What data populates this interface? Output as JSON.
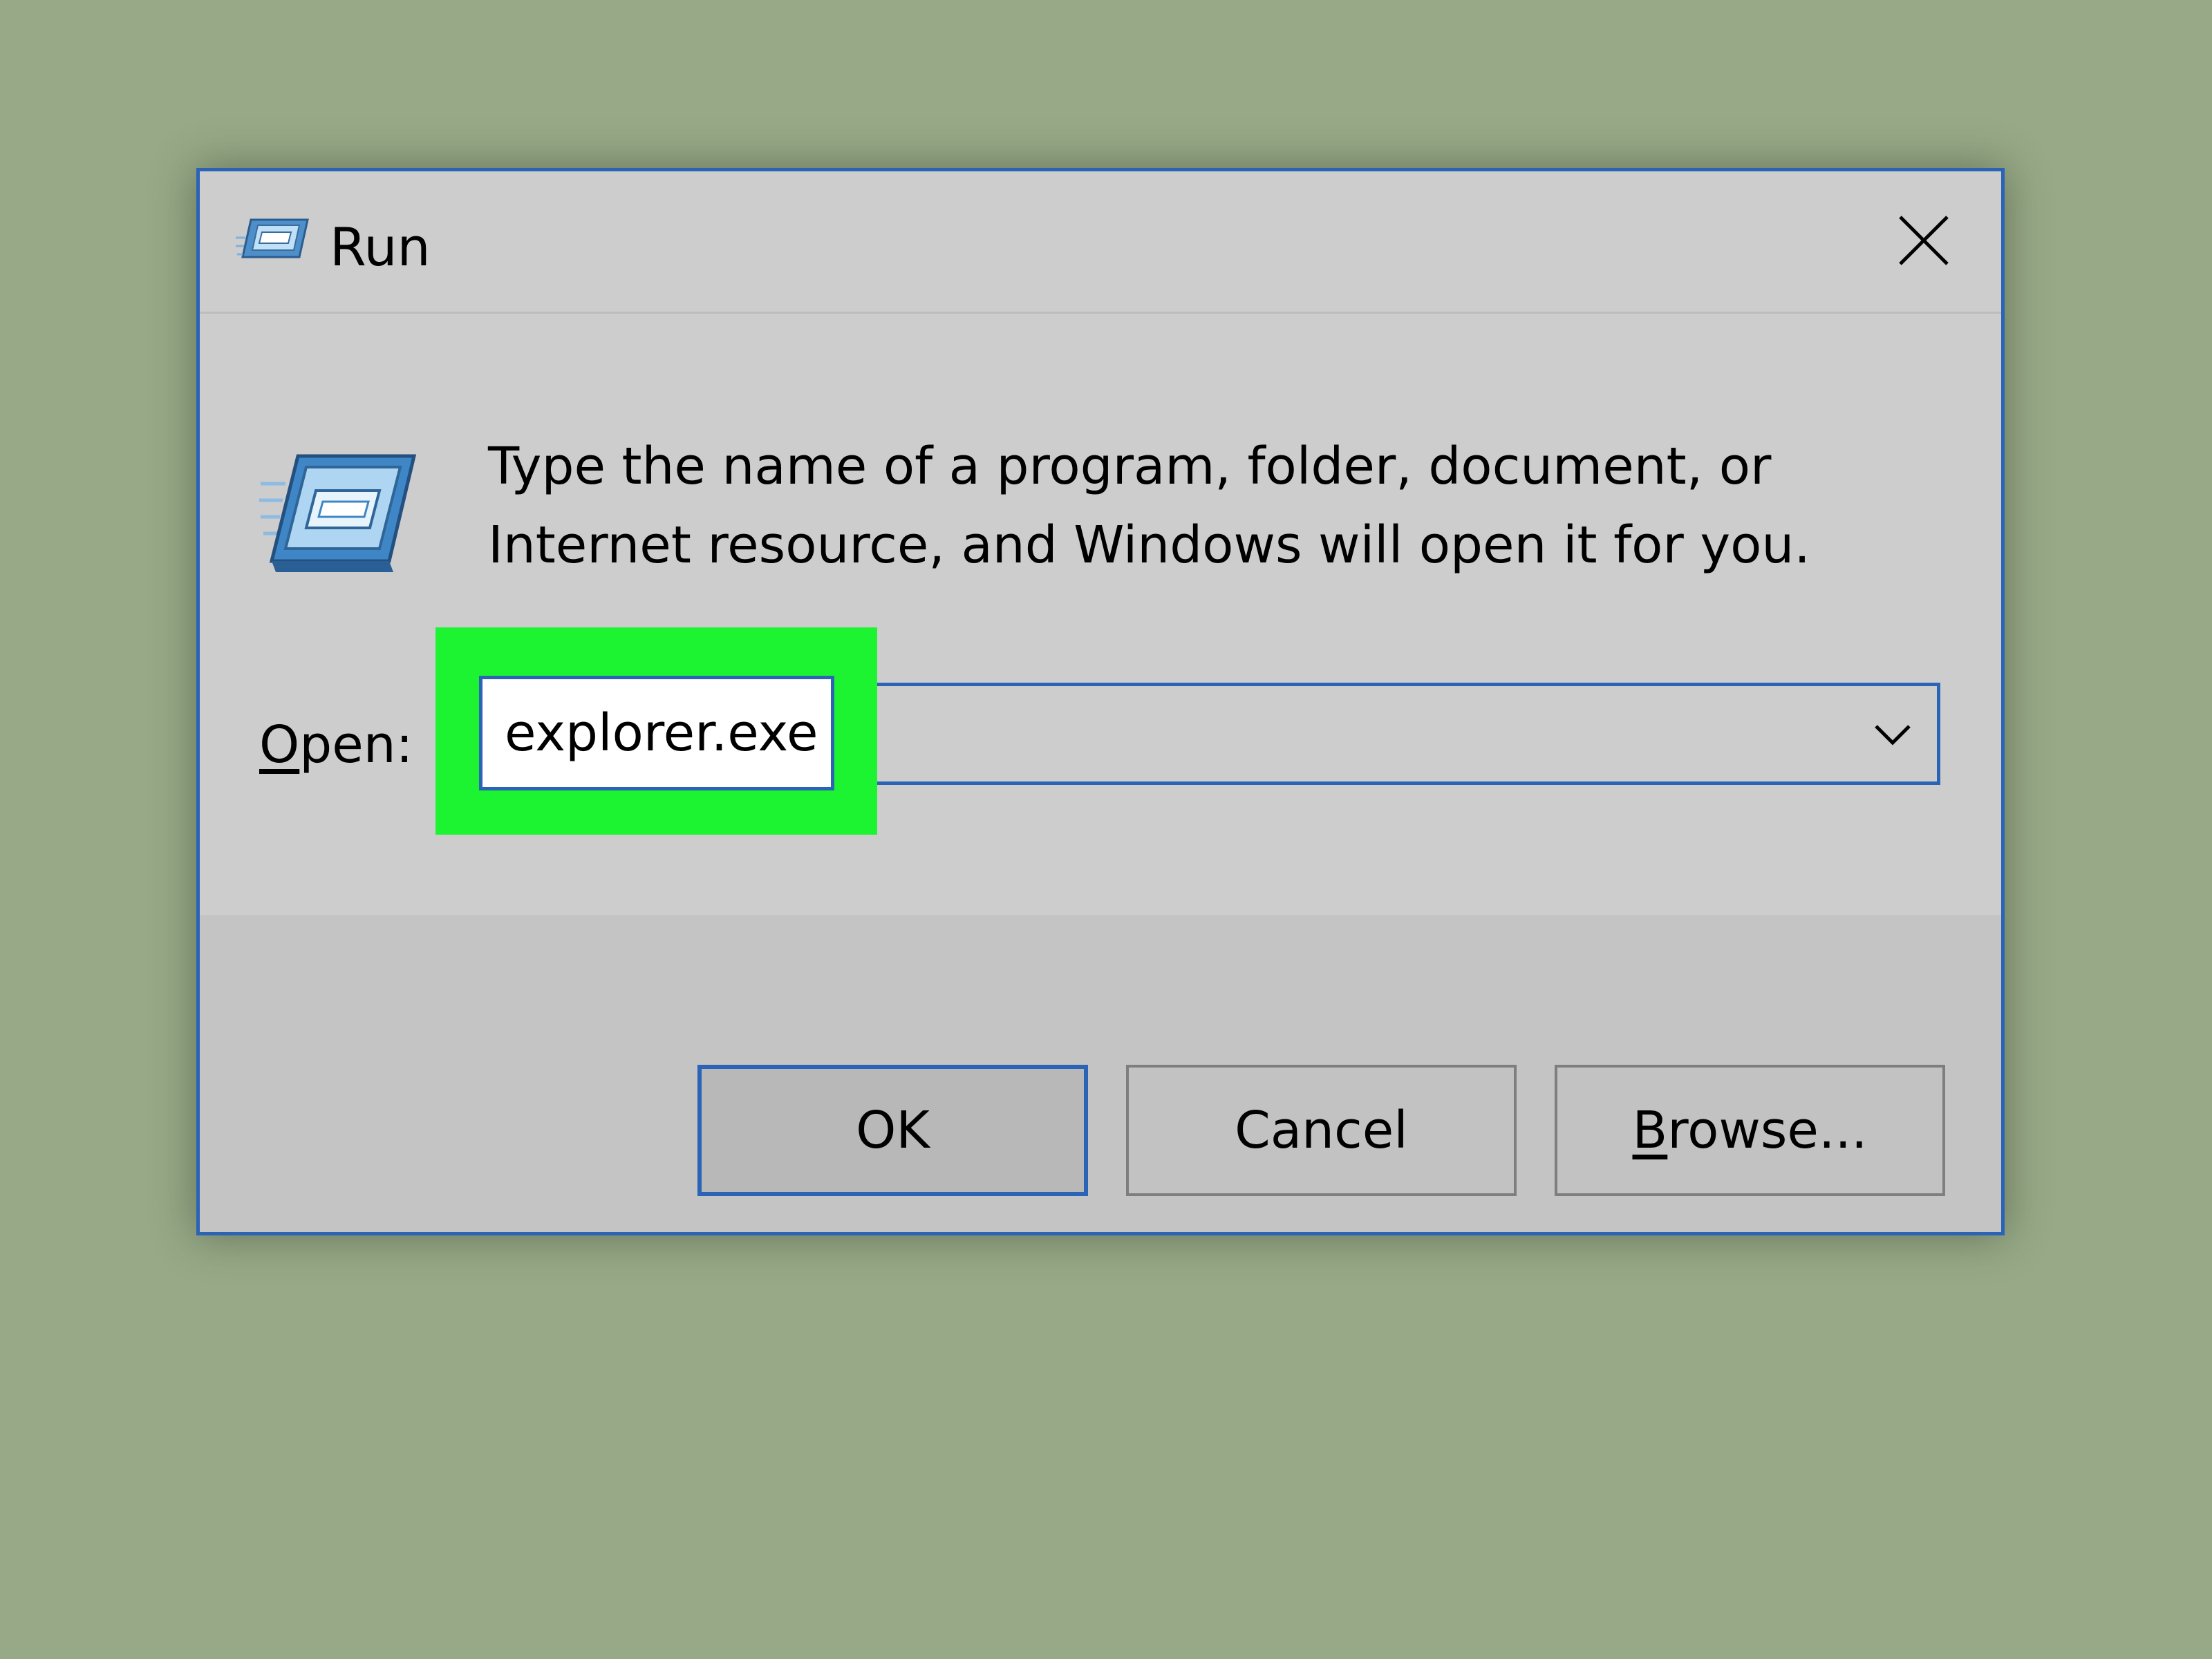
{
  "dialog": {
    "title": "Run",
    "description": "Type the name of a program, folder, document, or Internet resource, and Windows will open it for you.",
    "open_label_mnemonic": "O",
    "open_label_rest": "pen:",
    "open_value": "explorer.exe",
    "buttons": {
      "ok": "OK",
      "cancel": "Cancel",
      "browse_mnemonic": "B",
      "browse_rest": "rowse..."
    }
  },
  "colors": {
    "background": "#97a987",
    "dialog_border": "#2b63b6",
    "highlight": "#1cf432"
  },
  "icons": {
    "title": "run-icon",
    "close": "close-icon",
    "main": "run-icon",
    "dropdown": "chevron-down-icon"
  }
}
